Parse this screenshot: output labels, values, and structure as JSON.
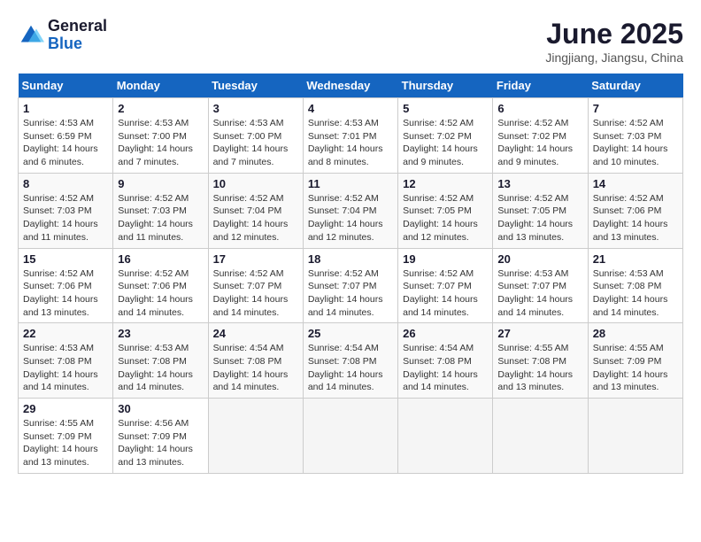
{
  "logo": {
    "general": "General",
    "blue": "Blue"
  },
  "title": {
    "month_year": "June 2025",
    "location": "Jingjiang, Jiangsu, China"
  },
  "days_of_week": [
    "Sunday",
    "Monday",
    "Tuesday",
    "Wednesday",
    "Thursday",
    "Friday",
    "Saturday"
  ],
  "weeks": [
    [
      {
        "day": "1",
        "sunrise": "4:53 AM",
        "sunset": "6:59 PM",
        "daylight": "14 hours and 6 minutes."
      },
      {
        "day": "2",
        "sunrise": "4:53 AM",
        "sunset": "7:00 PM",
        "daylight": "14 hours and 7 minutes."
      },
      {
        "day": "3",
        "sunrise": "4:53 AM",
        "sunset": "7:00 PM",
        "daylight": "14 hours and 7 minutes."
      },
      {
        "day": "4",
        "sunrise": "4:53 AM",
        "sunset": "7:01 PM",
        "daylight": "14 hours and 8 minutes."
      },
      {
        "day": "5",
        "sunrise": "4:52 AM",
        "sunset": "7:02 PM",
        "daylight": "14 hours and 9 minutes."
      },
      {
        "day": "6",
        "sunrise": "4:52 AM",
        "sunset": "7:02 PM",
        "daylight": "14 hours and 9 minutes."
      },
      {
        "day": "7",
        "sunrise": "4:52 AM",
        "sunset": "7:03 PM",
        "daylight": "14 hours and 10 minutes."
      }
    ],
    [
      {
        "day": "8",
        "sunrise": "4:52 AM",
        "sunset": "7:03 PM",
        "daylight": "14 hours and 11 minutes."
      },
      {
        "day": "9",
        "sunrise": "4:52 AM",
        "sunset": "7:03 PM",
        "daylight": "14 hours and 11 minutes."
      },
      {
        "day": "10",
        "sunrise": "4:52 AM",
        "sunset": "7:04 PM",
        "daylight": "14 hours and 12 minutes."
      },
      {
        "day": "11",
        "sunrise": "4:52 AM",
        "sunset": "7:04 PM",
        "daylight": "14 hours and 12 minutes."
      },
      {
        "day": "12",
        "sunrise": "4:52 AM",
        "sunset": "7:05 PM",
        "daylight": "14 hours and 12 minutes."
      },
      {
        "day": "13",
        "sunrise": "4:52 AM",
        "sunset": "7:05 PM",
        "daylight": "14 hours and 13 minutes."
      },
      {
        "day": "14",
        "sunrise": "4:52 AM",
        "sunset": "7:06 PM",
        "daylight": "14 hours and 13 minutes."
      }
    ],
    [
      {
        "day": "15",
        "sunrise": "4:52 AM",
        "sunset": "7:06 PM",
        "daylight": "14 hours and 13 minutes."
      },
      {
        "day": "16",
        "sunrise": "4:52 AM",
        "sunset": "7:06 PM",
        "daylight": "14 hours and 14 minutes."
      },
      {
        "day": "17",
        "sunrise": "4:52 AM",
        "sunset": "7:07 PM",
        "daylight": "14 hours and 14 minutes."
      },
      {
        "day": "18",
        "sunrise": "4:52 AM",
        "sunset": "7:07 PM",
        "daylight": "14 hours and 14 minutes."
      },
      {
        "day": "19",
        "sunrise": "4:52 AM",
        "sunset": "7:07 PM",
        "daylight": "14 hours and 14 minutes."
      },
      {
        "day": "20",
        "sunrise": "4:53 AM",
        "sunset": "7:07 PM",
        "daylight": "14 hours and 14 minutes."
      },
      {
        "day": "21",
        "sunrise": "4:53 AM",
        "sunset": "7:08 PM",
        "daylight": "14 hours and 14 minutes."
      }
    ],
    [
      {
        "day": "22",
        "sunrise": "4:53 AM",
        "sunset": "7:08 PM",
        "daylight": "14 hours and 14 minutes."
      },
      {
        "day": "23",
        "sunrise": "4:53 AM",
        "sunset": "7:08 PM",
        "daylight": "14 hours and 14 minutes."
      },
      {
        "day": "24",
        "sunrise": "4:54 AM",
        "sunset": "7:08 PM",
        "daylight": "14 hours and 14 minutes."
      },
      {
        "day": "25",
        "sunrise": "4:54 AM",
        "sunset": "7:08 PM",
        "daylight": "14 hours and 14 minutes."
      },
      {
        "day": "26",
        "sunrise": "4:54 AM",
        "sunset": "7:08 PM",
        "daylight": "14 hours and 14 minutes."
      },
      {
        "day": "27",
        "sunrise": "4:55 AM",
        "sunset": "7:08 PM",
        "daylight": "14 hours and 13 minutes."
      },
      {
        "day": "28",
        "sunrise": "4:55 AM",
        "sunset": "7:09 PM",
        "daylight": "14 hours and 13 minutes."
      }
    ],
    [
      {
        "day": "29",
        "sunrise": "4:55 AM",
        "sunset": "7:09 PM",
        "daylight": "14 hours and 13 minutes."
      },
      {
        "day": "30",
        "sunrise": "4:56 AM",
        "sunset": "7:09 PM",
        "daylight": "14 hours and 13 minutes."
      },
      null,
      null,
      null,
      null,
      null
    ]
  ]
}
